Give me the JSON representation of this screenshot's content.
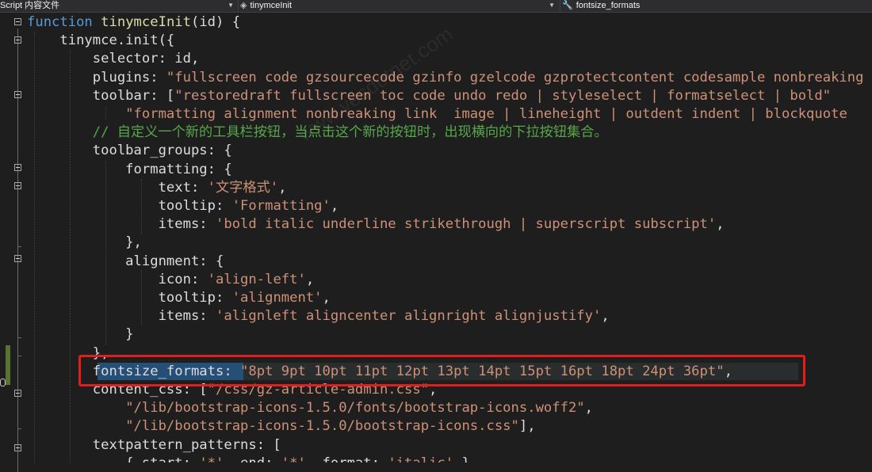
{
  "navbar": {
    "project": "Script 内容文件",
    "scope": "tinymceInit",
    "member": "fontsize_formats"
  },
  "code": {
    "lines": [
      [
        {
          "c": "kw",
          "t": "function"
        },
        {
          "c": "",
          "t": " "
        },
        {
          "c": "fn",
          "t": "tinymceInit"
        },
        {
          "c": "",
          "t": "(id) {"
        }
      ],
      [
        {
          "c": "",
          "t": "    tinymce.init({"
        }
      ],
      [
        {
          "c": "",
          "t": "        selector: id,"
        }
      ],
      [
        {
          "c": "",
          "t": "        plugins: "
        },
        {
          "c": "str",
          "t": "\"fullscreen code gzsourcecode gzinfo gzelcode gzprotectcontent codesample nonbreaking"
        }
      ],
      [
        {
          "c": "",
          "t": "        toolbar: ["
        },
        {
          "c": "str",
          "t": "\"restoredraft fullscreen toc code undo redo | styleselect | formatselect | bold\""
        }
      ],
      [
        {
          "c": "",
          "t": "            "
        },
        {
          "c": "str",
          "t": "\"formatting alignment nonbreaking link  image | lineheight | outdent indent | blockquote"
        }
      ],
      [
        {
          "c": "cmt",
          "t": "        // 自定义一个新的工具栏按钮，当点击这个新的按钮时，出现横向的下拉按钮集合。"
        }
      ],
      [
        {
          "c": "",
          "t": "        toolbar_groups: {"
        }
      ],
      [
        {
          "c": "",
          "t": "            formatting: {"
        }
      ],
      [
        {
          "c": "",
          "t": "                text: "
        },
        {
          "c": "str",
          "t": "'文字格式'"
        },
        {
          "c": "",
          "t": ","
        }
      ],
      [
        {
          "c": "",
          "t": "                tooltip: "
        },
        {
          "c": "str",
          "t": "'Formatting'"
        },
        {
          "c": "",
          "t": ","
        }
      ],
      [
        {
          "c": "",
          "t": "                items: "
        },
        {
          "c": "str",
          "t": "'bold italic underline strikethrough | superscript subscript'"
        },
        {
          "c": "",
          "t": ","
        }
      ],
      [
        {
          "c": "",
          "t": "            },"
        }
      ],
      [
        {
          "c": "",
          "t": "            alignment: {"
        }
      ],
      [
        {
          "c": "",
          "t": "                icon: "
        },
        {
          "c": "str",
          "t": "'align-left'"
        },
        {
          "c": "",
          "t": ","
        }
      ],
      [
        {
          "c": "",
          "t": "                tooltip: "
        },
        {
          "c": "str",
          "t": "'alignment'"
        },
        {
          "c": "",
          "t": ","
        }
      ],
      [
        {
          "c": "",
          "t": "                items: "
        },
        {
          "c": "str",
          "t": "'alignleft aligncenter alignright alignjustify'"
        },
        {
          "c": "",
          "t": ","
        }
      ],
      [
        {
          "c": "",
          "t": "            }"
        }
      ],
      [
        {
          "c": "",
          "t": "        },"
        }
      ],
      [
        {
          "c": "",
          "t": "        fontsize_formats: "
        },
        {
          "c": "str",
          "t": "\"8pt 9pt 10pt 11pt 12pt 13pt 14pt 15pt 16pt 18pt 24pt 36pt\""
        },
        {
          "c": "",
          "t": ","
        }
      ],
      [
        {
          "c": "",
          "t": "        content_css: ["
        },
        {
          "c": "str",
          "t": "\"/css/gz-article-admin.css\""
        },
        {
          "c": "",
          "t": ","
        }
      ],
      [
        {
          "c": "",
          "t": "            "
        },
        {
          "c": "str",
          "t": "\"/lib/bootstrap-icons-1.5.0/fonts/bootstrap-icons.woff2\""
        },
        {
          "c": "",
          "t": ","
        }
      ],
      [
        {
          "c": "",
          "t": "            "
        },
        {
          "c": "str",
          "t": "\"/lib/bootstrap-icons-1.5.0/bootstrap-icons.css\""
        },
        {
          "c": "",
          "t": "],"
        }
      ],
      [
        {
          "c": "",
          "t": "        textpattern_patterns: ["
        }
      ],
      [
        {
          "c": "",
          "t": "            { start: "
        },
        {
          "c": "str",
          "t": "'*'"
        },
        {
          "c": "",
          "t": ", end: "
        },
        {
          "c": "str",
          "t": "'*'"
        },
        {
          "c": "",
          "t": ", format: "
        },
        {
          "c": "str",
          "t": "'italic'"
        },
        {
          "c": "",
          "t": " },"
        }
      ]
    ]
  }
}
